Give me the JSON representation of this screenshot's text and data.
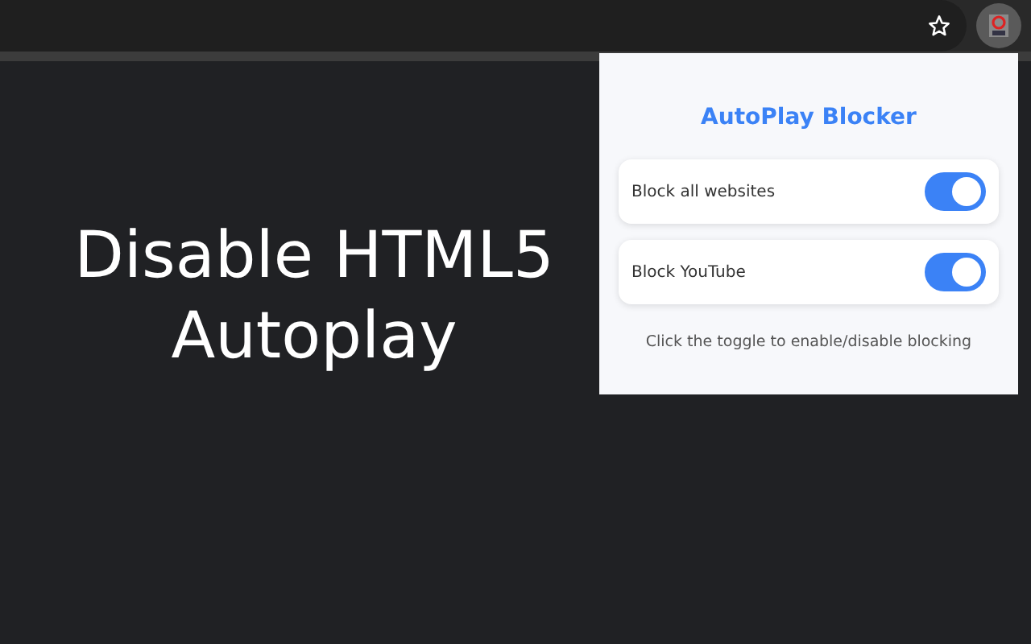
{
  "headline": "Disable HTML5 Autoplay",
  "popup": {
    "title": "AutoPlay Blocker",
    "toggles": [
      {
        "label": "Block all websites",
        "on": true
      },
      {
        "label": "Block YouTube",
        "on": true
      }
    ],
    "hint": "Click the toggle to enable/disable blocking"
  }
}
